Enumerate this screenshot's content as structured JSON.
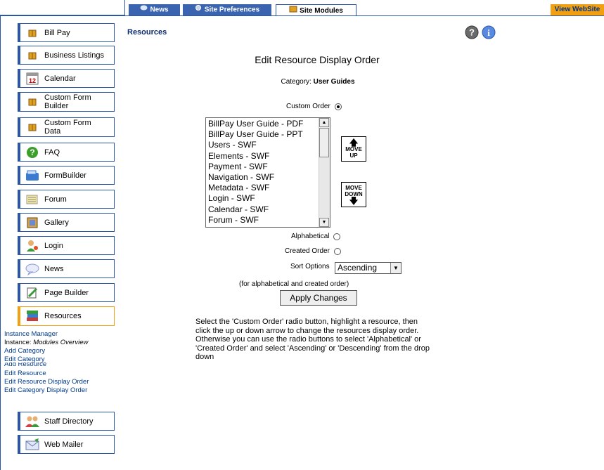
{
  "topbar": {
    "tabs": [
      {
        "label": "News",
        "icon": "chat-bubble-icon"
      },
      {
        "label": "Site Preferences",
        "icon": "gear-icon"
      },
      {
        "label": "Site Modules",
        "icon": "box-icon"
      }
    ],
    "view_site": "View WebSite",
    "colors": {
      "accent": "#2a55a8",
      "tab_blue": "#3b64b0",
      "view_site_bg": "#f0a010"
    }
  },
  "sidebar": {
    "modules": [
      {
        "label": "Bill Pay",
        "icon": "box-icon"
      },
      {
        "label": "Business Listings",
        "icon": "box-icon"
      },
      {
        "label": "Calendar",
        "icon": "calendar-icon"
      },
      {
        "label": "Custom Form Builder",
        "icon": "box-icon"
      },
      {
        "label": "Custom Form Data",
        "icon": "box-icon"
      },
      {
        "label": "FAQ",
        "icon": "question-icon"
      },
      {
        "label": "FormBuilder",
        "icon": "formbuilder-icon"
      },
      {
        "label": "Forum",
        "icon": "forum-icon"
      },
      {
        "label": "Gallery",
        "icon": "gallery-icon"
      },
      {
        "label": "Login",
        "icon": "login-icon"
      },
      {
        "label": "News",
        "icon": "news-icon"
      },
      {
        "label": "Page Builder",
        "icon": "page-builder-icon"
      },
      {
        "label": "Resources",
        "icon": "resources-icon"
      },
      {
        "label": "Staff Directory",
        "icon": "staff-icon"
      },
      {
        "label": "Web Mailer",
        "icon": "mailer-icon"
      }
    ],
    "sublinks": {
      "instance_manager": "Instance Manager",
      "instance_label": "Instance:",
      "instance_value": "Modules Overview",
      "add_category": "Add Category",
      "edit_category": "Edit Category",
      "add_resource": "Add Resource",
      "edit_resource": "Edit Resource",
      "edit_resource_order": "Edit Resource Display Order",
      "edit_category_order": "Edit Category Display Order"
    }
  },
  "main": {
    "breadcrumb": "Resources",
    "heading": "Edit Resource Display Order",
    "category_label": "Category:",
    "category_value": "User Guides",
    "custom_order_label": "Custom Order",
    "resources": [
      "BillPay User Guide - PDF",
      "BillPay User Guide - PPT",
      "Users - SWF",
      "Elements - SWF",
      "Payment - SWF",
      "Navigation - SWF",
      "Metadata - SWF",
      "Login - SWF",
      "Calendar - SWF",
      "Forum - SWF"
    ],
    "move_up": {
      "line1": "MOVE",
      "line2": "UP"
    },
    "move_down": {
      "line1": "MOVE",
      "line2": "DOWN"
    },
    "alphabetical_label": "Alphabetical",
    "created_order_label": "Created Order",
    "sort_options_label": "Sort Options",
    "sort_value": "Ascending",
    "sort_hint": "(for alphabetical and created order)",
    "apply_button": "Apply Changes",
    "description": "Select the 'Custom Order' radio button, highlight a resource, then click the up or down arrow to change the resources display order. Otherwise you can use the radio buttons to select 'Alphabetical' or 'Created Order' and select 'Ascending' or 'Descending' from the drop down"
  }
}
